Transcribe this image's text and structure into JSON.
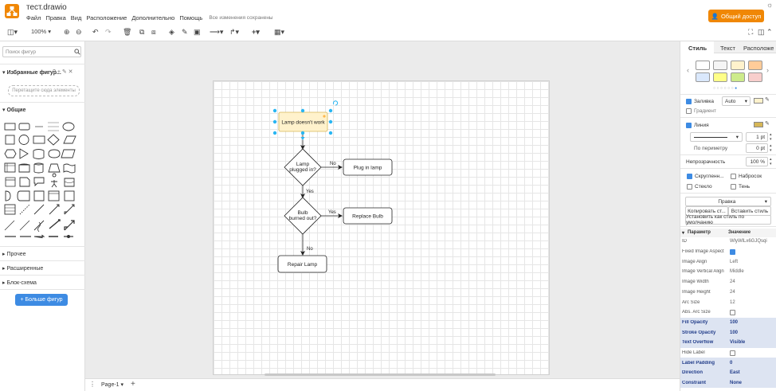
{
  "app": {
    "title": "тест.drawio",
    "saved_status": "Все изменения сохранены",
    "share_label": "Общий доступ"
  },
  "menu": [
    "Файл",
    "Правка",
    "Вид",
    "Расположение",
    "Дополнительно",
    "Помощь"
  ],
  "toolbar": {
    "zoom": "100%"
  },
  "sidebar": {
    "search_placeholder": "Поиск фигур",
    "favorites": "Избранные фигур...",
    "dropzone": "Перетащите сюда элементы",
    "general": "Общие",
    "other": "Прочее",
    "advanced": "Расширенные",
    "flowchart": "Блок-схема",
    "more_shapes": "Больше фигур"
  },
  "diagram": {
    "start": "Lamp doesn't work",
    "d1": [
      "Lamp",
      "plugged in?"
    ],
    "plug": "Plug in lamp",
    "d2": [
      "Bulb",
      "burned out?"
    ],
    "replace": "Replace Bulb",
    "repair": "Repair Lamp",
    "no1": "No",
    "yes1": "Yes",
    "yes2": "Yes",
    "no2": "No"
  },
  "pages": {
    "current": "Page-1"
  },
  "format": {
    "tabs": [
      "Стиль",
      "Текст",
      "Расположе"
    ],
    "swatch_colors": [
      "#ffffff",
      "#f5f5f5",
      "#fff2cc",
      "#ffcc99",
      "#dae8fc",
      "#ffff88",
      "#cdeb8b",
      "#f8cecc"
    ],
    "fill_label": "Заливка",
    "fill_mode": "Auto",
    "fill_color": "#fff2cc",
    "gradient_label": "Градиент",
    "line_label": "Линия",
    "line_color": "#d6b656",
    "line_width": "1 pt",
    "perimeter_label": "По периметру",
    "perimeter_value": "0 pt",
    "opacity_label": "Непрозрачность",
    "opacity_value": "100 %",
    "rounded_label": "Скругленн...",
    "sketch_label": "Набросок",
    "glass_label": "Стекло",
    "shadow_label": "Тень",
    "edit_label": "Правка",
    "copy_style": "Копировать ст...",
    "paste_style": "Вставить стиль",
    "default_style": "Установить как стиль по умолчанию"
  },
  "properties": {
    "col_param": "Параметр",
    "col_value": "Значение",
    "rows": [
      {
        "k": "ID",
        "v": "WlyWlLx6GJQsqi",
        "type": "text"
      },
      {
        "k": "Fixed Image Aspect",
        "v": "",
        "type": "check_on"
      },
      {
        "k": "Image Align",
        "v": "Left",
        "type": "text"
      },
      {
        "k": "Image Vertical Align",
        "v": "Middle",
        "type": "text"
      },
      {
        "k": "Image Width",
        "v": "24",
        "type": "text"
      },
      {
        "k": "Image Height",
        "v": "24",
        "type": "text"
      },
      {
        "k": "Arc Size",
        "v": "12",
        "type": "text"
      },
      {
        "k": "Abs. Arc Size",
        "v": "",
        "type": "check_off"
      },
      {
        "k": "Fill Opacity",
        "v": "100",
        "type": "hl"
      },
      {
        "k": "Stroke Opacity",
        "v": "100",
        "type": "hl"
      },
      {
        "k": "Text Overflow",
        "v": "Visible",
        "type": "hl"
      },
      {
        "k": "Hide Label",
        "v": "",
        "type": "check_off"
      },
      {
        "k": "Label Padding",
        "v": "0",
        "type": "hl"
      },
      {
        "k": "Direction",
        "v": "East",
        "type": "hl"
      },
      {
        "k": "Constraint",
        "v": "None",
        "type": "hl"
      }
    ]
  }
}
